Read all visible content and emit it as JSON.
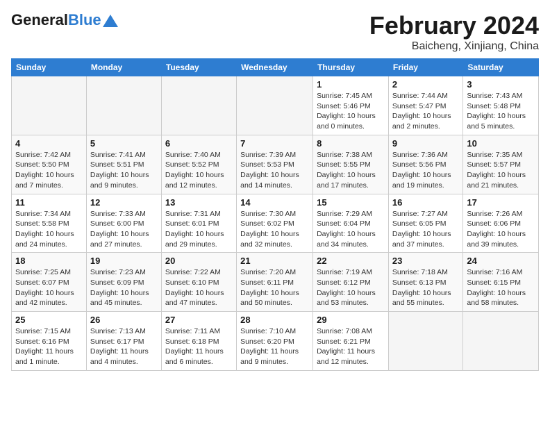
{
  "header": {
    "logo_general": "General",
    "logo_blue": "Blue",
    "month_year": "February 2024",
    "location": "Baicheng, Xinjiang, China"
  },
  "weekdays": [
    "Sunday",
    "Monday",
    "Tuesday",
    "Wednesday",
    "Thursday",
    "Friday",
    "Saturday"
  ],
  "weeks": [
    [
      {
        "day": "",
        "sunrise": "",
        "sunset": "",
        "daylight": "",
        "empty": true
      },
      {
        "day": "",
        "sunrise": "",
        "sunset": "",
        "daylight": "",
        "empty": true
      },
      {
        "day": "",
        "sunrise": "",
        "sunset": "",
        "daylight": "",
        "empty": true
      },
      {
        "day": "",
        "sunrise": "",
        "sunset": "",
        "daylight": "",
        "empty": true
      },
      {
        "day": "1",
        "sunrise": "Sunrise: 7:45 AM",
        "sunset": "Sunset: 5:46 PM",
        "daylight": "Daylight: 10 hours and 0 minutes.",
        "empty": false
      },
      {
        "day": "2",
        "sunrise": "Sunrise: 7:44 AM",
        "sunset": "Sunset: 5:47 PM",
        "daylight": "Daylight: 10 hours and 2 minutes.",
        "empty": false
      },
      {
        "day": "3",
        "sunrise": "Sunrise: 7:43 AM",
        "sunset": "Sunset: 5:48 PM",
        "daylight": "Daylight: 10 hours and 5 minutes.",
        "empty": false
      }
    ],
    [
      {
        "day": "4",
        "sunrise": "Sunrise: 7:42 AM",
        "sunset": "Sunset: 5:50 PM",
        "daylight": "Daylight: 10 hours and 7 minutes.",
        "empty": false
      },
      {
        "day": "5",
        "sunrise": "Sunrise: 7:41 AM",
        "sunset": "Sunset: 5:51 PM",
        "daylight": "Daylight: 10 hours and 9 minutes.",
        "empty": false
      },
      {
        "day": "6",
        "sunrise": "Sunrise: 7:40 AM",
        "sunset": "Sunset: 5:52 PM",
        "daylight": "Daylight: 10 hours and 12 minutes.",
        "empty": false
      },
      {
        "day": "7",
        "sunrise": "Sunrise: 7:39 AM",
        "sunset": "Sunset: 5:53 PM",
        "daylight": "Daylight: 10 hours and 14 minutes.",
        "empty": false
      },
      {
        "day": "8",
        "sunrise": "Sunrise: 7:38 AM",
        "sunset": "Sunset: 5:55 PM",
        "daylight": "Daylight: 10 hours and 17 minutes.",
        "empty": false
      },
      {
        "day": "9",
        "sunrise": "Sunrise: 7:36 AM",
        "sunset": "Sunset: 5:56 PM",
        "daylight": "Daylight: 10 hours and 19 minutes.",
        "empty": false
      },
      {
        "day": "10",
        "sunrise": "Sunrise: 7:35 AM",
        "sunset": "Sunset: 5:57 PM",
        "daylight": "Daylight: 10 hours and 21 minutes.",
        "empty": false
      }
    ],
    [
      {
        "day": "11",
        "sunrise": "Sunrise: 7:34 AM",
        "sunset": "Sunset: 5:58 PM",
        "daylight": "Daylight: 10 hours and 24 minutes.",
        "empty": false
      },
      {
        "day": "12",
        "sunrise": "Sunrise: 7:33 AM",
        "sunset": "Sunset: 6:00 PM",
        "daylight": "Daylight: 10 hours and 27 minutes.",
        "empty": false
      },
      {
        "day": "13",
        "sunrise": "Sunrise: 7:31 AM",
        "sunset": "Sunset: 6:01 PM",
        "daylight": "Daylight: 10 hours and 29 minutes.",
        "empty": false
      },
      {
        "day": "14",
        "sunrise": "Sunrise: 7:30 AM",
        "sunset": "Sunset: 6:02 PM",
        "daylight": "Daylight: 10 hours and 32 minutes.",
        "empty": false
      },
      {
        "day": "15",
        "sunrise": "Sunrise: 7:29 AM",
        "sunset": "Sunset: 6:04 PM",
        "daylight": "Daylight: 10 hours and 34 minutes.",
        "empty": false
      },
      {
        "day": "16",
        "sunrise": "Sunrise: 7:27 AM",
        "sunset": "Sunset: 6:05 PM",
        "daylight": "Daylight: 10 hours and 37 minutes.",
        "empty": false
      },
      {
        "day": "17",
        "sunrise": "Sunrise: 7:26 AM",
        "sunset": "Sunset: 6:06 PM",
        "daylight": "Daylight: 10 hours and 39 minutes.",
        "empty": false
      }
    ],
    [
      {
        "day": "18",
        "sunrise": "Sunrise: 7:25 AM",
        "sunset": "Sunset: 6:07 PM",
        "daylight": "Daylight: 10 hours and 42 minutes.",
        "empty": false
      },
      {
        "day": "19",
        "sunrise": "Sunrise: 7:23 AM",
        "sunset": "Sunset: 6:09 PM",
        "daylight": "Daylight: 10 hours and 45 minutes.",
        "empty": false
      },
      {
        "day": "20",
        "sunrise": "Sunrise: 7:22 AM",
        "sunset": "Sunset: 6:10 PM",
        "daylight": "Daylight: 10 hours and 47 minutes.",
        "empty": false
      },
      {
        "day": "21",
        "sunrise": "Sunrise: 7:20 AM",
        "sunset": "Sunset: 6:11 PM",
        "daylight": "Daylight: 10 hours and 50 minutes.",
        "empty": false
      },
      {
        "day": "22",
        "sunrise": "Sunrise: 7:19 AM",
        "sunset": "Sunset: 6:12 PM",
        "daylight": "Daylight: 10 hours and 53 minutes.",
        "empty": false
      },
      {
        "day": "23",
        "sunrise": "Sunrise: 7:18 AM",
        "sunset": "Sunset: 6:13 PM",
        "daylight": "Daylight: 10 hours and 55 minutes.",
        "empty": false
      },
      {
        "day": "24",
        "sunrise": "Sunrise: 7:16 AM",
        "sunset": "Sunset: 6:15 PM",
        "daylight": "Daylight: 10 hours and 58 minutes.",
        "empty": false
      }
    ],
    [
      {
        "day": "25",
        "sunrise": "Sunrise: 7:15 AM",
        "sunset": "Sunset: 6:16 PM",
        "daylight": "Daylight: 11 hours and 1 minute.",
        "empty": false
      },
      {
        "day": "26",
        "sunrise": "Sunrise: 7:13 AM",
        "sunset": "Sunset: 6:17 PM",
        "daylight": "Daylight: 11 hours and 4 minutes.",
        "empty": false
      },
      {
        "day": "27",
        "sunrise": "Sunrise: 7:11 AM",
        "sunset": "Sunset: 6:18 PM",
        "daylight": "Daylight: 11 hours and 6 minutes.",
        "empty": false
      },
      {
        "day": "28",
        "sunrise": "Sunrise: 7:10 AM",
        "sunset": "Sunset: 6:20 PM",
        "daylight": "Daylight: 11 hours and 9 minutes.",
        "empty": false
      },
      {
        "day": "29",
        "sunrise": "Sunrise: 7:08 AM",
        "sunset": "Sunset: 6:21 PM",
        "daylight": "Daylight: 11 hours and 12 minutes.",
        "empty": false
      },
      {
        "day": "",
        "sunrise": "",
        "sunset": "",
        "daylight": "",
        "empty": true
      },
      {
        "day": "",
        "sunrise": "",
        "sunset": "",
        "daylight": "",
        "empty": true
      }
    ]
  ]
}
